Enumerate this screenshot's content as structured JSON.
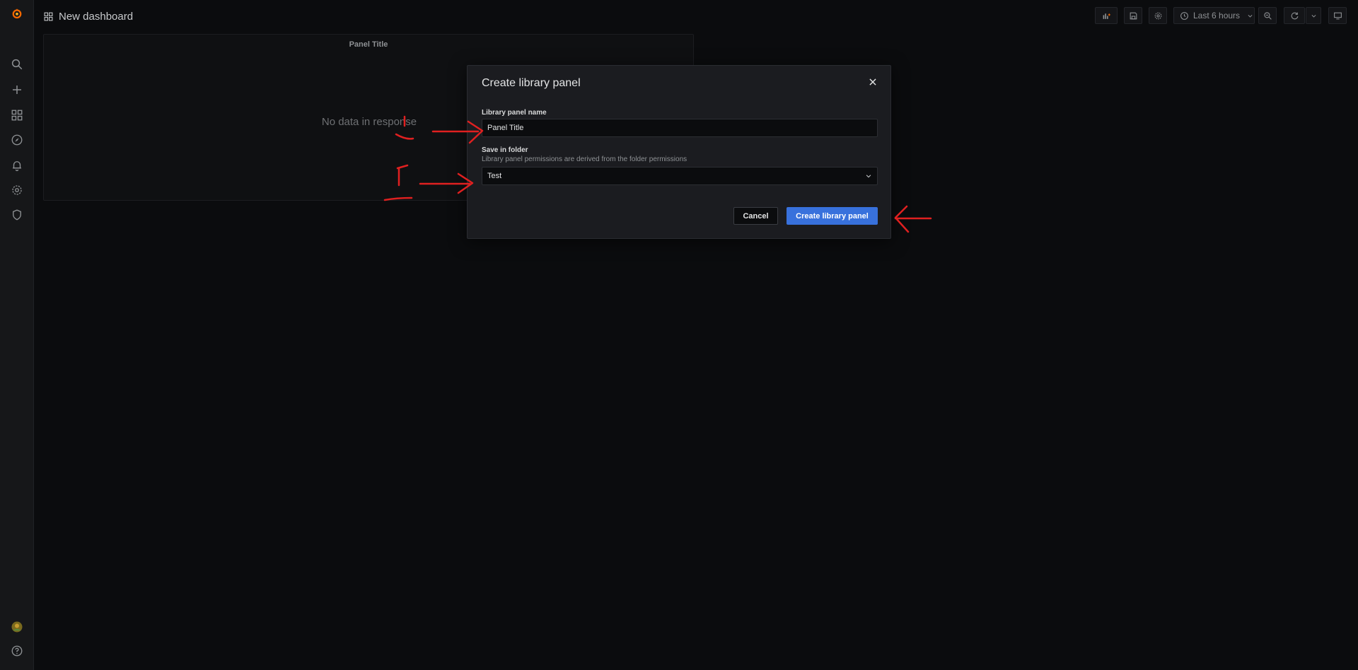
{
  "topbar": {
    "dashboard_title": "New dashboard",
    "time_range_label": "Last 6 hours"
  },
  "panel": {
    "title": "Panel Title",
    "no_data": "No data in response"
  },
  "modal": {
    "title": "Create library panel",
    "name_label": "Library panel name",
    "name_value": "Panel Title",
    "folder_label": "Save in folder",
    "folder_description": "Library panel permissions are derived from the folder permissions",
    "folder_value": "Test",
    "cancel_label": "Cancel",
    "create_label": "Create library panel"
  },
  "annotation_color": "#e02020",
  "accent_color": "#3871dc"
}
